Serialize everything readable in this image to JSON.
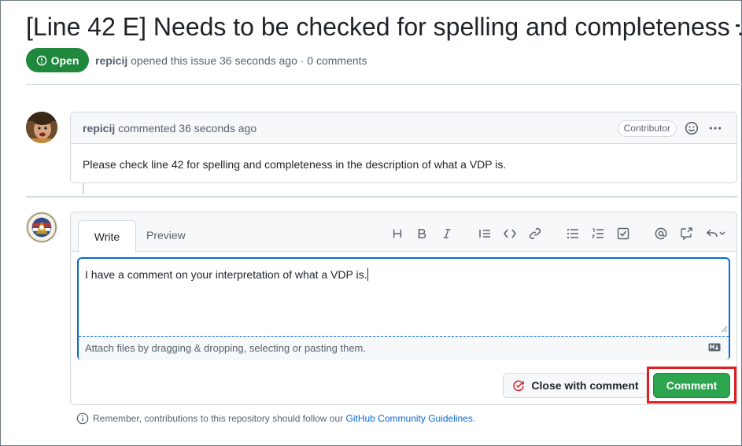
{
  "issue": {
    "title": "[Line 42 E] Needs to be checked for spelling and completeness .",
    "state": "Open",
    "author": "repicij",
    "opened_text": "opened this issue 36 seconds ago · 0 comments"
  },
  "comment": {
    "author": "repicij",
    "time_text": "commented 36 seconds ago",
    "role_badge": "Contributor",
    "body": "Please check line 42 for spelling and completeness in the description of what a VDP is."
  },
  "editor": {
    "tabs": [
      "Write",
      "Preview"
    ],
    "active_tab": "Write",
    "value": "I have a comment on your interpretation of what a VDP is.",
    "attach_hint": "Attach files by dragging & dropping, selecting or pasting them.",
    "toolbar_icons": [
      "heading-icon",
      "bold-icon",
      "italic-icon",
      "quote-icon",
      "code-icon",
      "link-icon",
      "unordered-list-icon",
      "ordered-list-icon",
      "task-list-icon",
      "mention-icon",
      "reference-icon",
      "reply-icon"
    ]
  },
  "actions": {
    "close_label": "Close with comment",
    "comment_label": "Comment"
  },
  "footer": {
    "prefix": "Remember, contributions to this repository should follow our",
    "link": "GitHub Community Guidelines",
    "suffix": "."
  },
  "colors": {
    "open_green": "#1f883d",
    "comment_green": "#2da44e",
    "highlight_red": "#e11d1d",
    "link_blue": "#0969da"
  }
}
